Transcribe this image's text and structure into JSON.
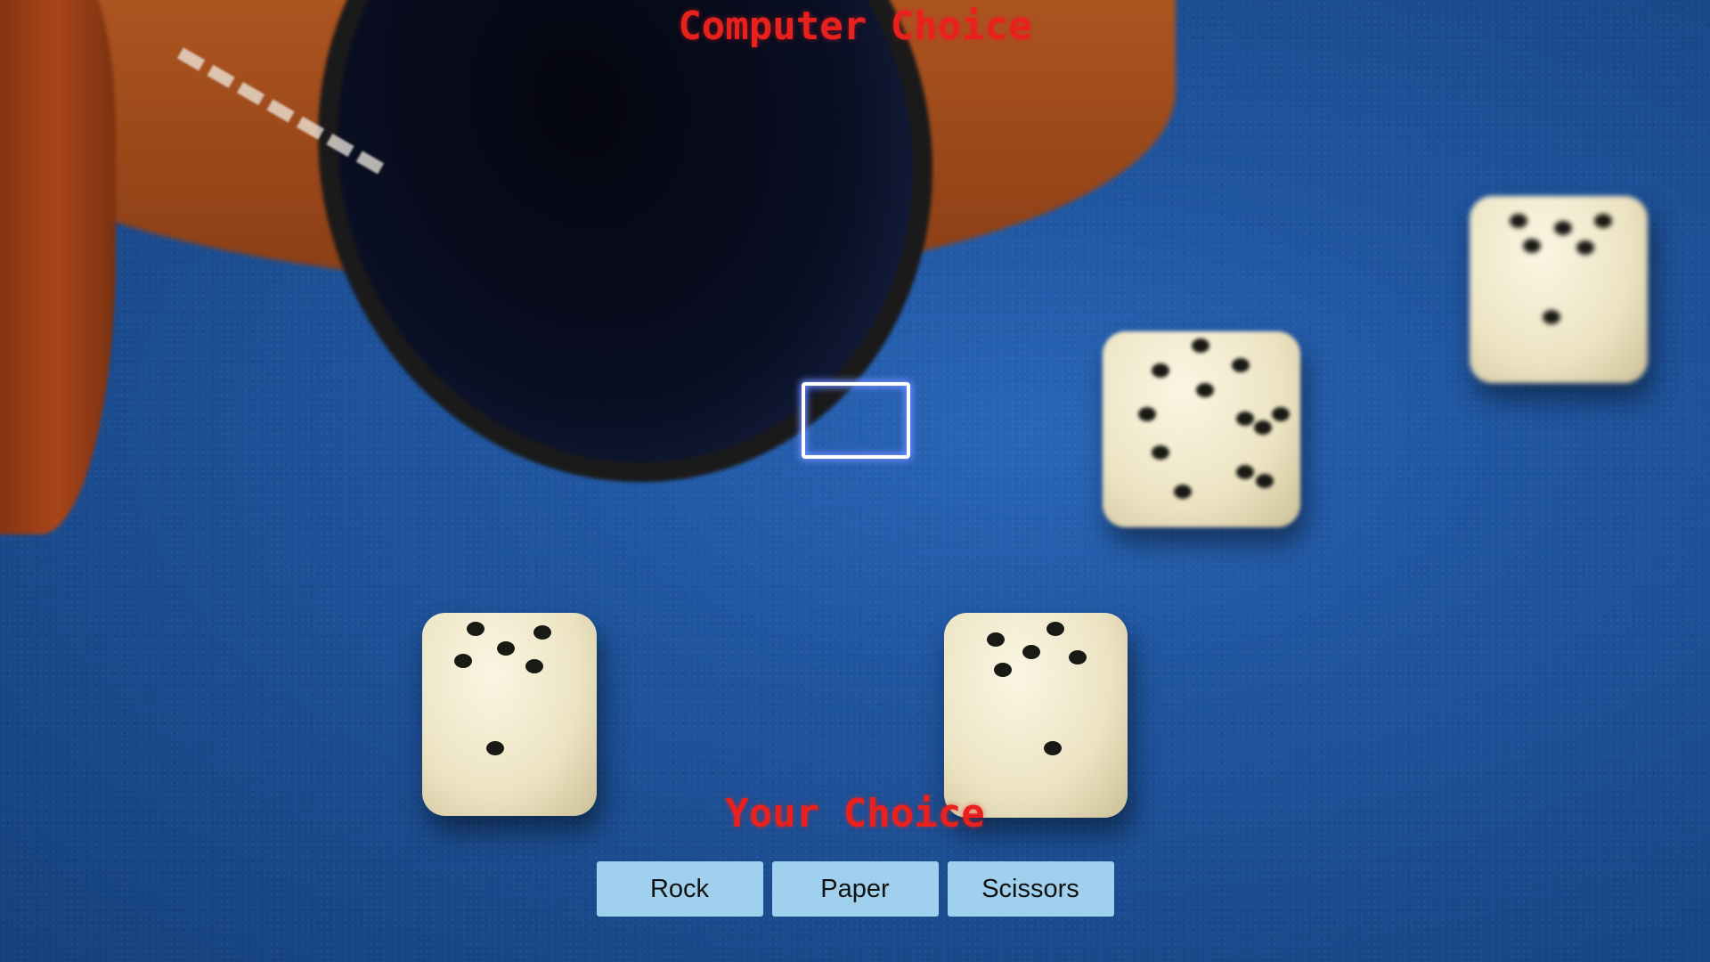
{
  "game": {
    "computer_title": "Computer Choice",
    "player_title": "Your Choice",
    "computer_choice_value": "",
    "choices": [
      {
        "label": "Rock"
      },
      {
        "label": "Paper"
      },
      {
        "label": "Scissors"
      }
    ]
  },
  "colors": {
    "title_text": "#e8201e",
    "button_background": "#9fd1ef",
    "choice_box_glow": "#6e8cff",
    "table_felt": "#1f559f"
  },
  "background": {
    "scene": "dice cup and dice on blue felt table"
  }
}
